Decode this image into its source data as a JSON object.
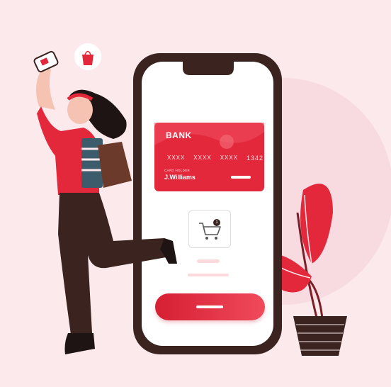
{
  "card": {
    "brand": "BANK",
    "number_groups": [
      "XXXX",
      "XXXX",
      "XXXX",
      "1342"
    ],
    "holder_label": "CARD HOLDER",
    "holder_name": "J.Williams"
  },
  "cart": {
    "item_count": "1"
  },
  "colors": {
    "background": "#fbe9ec",
    "accent_red": "#e3283c",
    "phone_frame": "#3b2320",
    "screen": "#ffffff"
  },
  "icons": [
    "shopping-bag-icon",
    "cart-icon",
    "phone-icon"
  ]
}
